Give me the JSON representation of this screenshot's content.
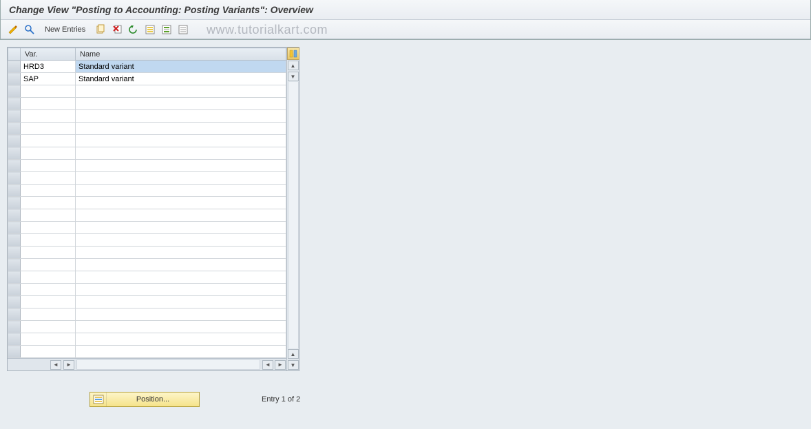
{
  "title": "Change View \"Posting to Accounting: Posting Variants\": Overview",
  "toolbar": {
    "new_entries": "New Entries"
  },
  "watermark": "www.tutorialkart.com",
  "columns": {
    "var": "Var.",
    "name": "Name"
  },
  "rows": [
    {
      "var": "HRD3",
      "name": "Standard variant",
      "selected": true
    },
    {
      "var": "SAP",
      "name": "Standard variant",
      "selected": false
    }
  ],
  "empty_row_count": 22,
  "footer": {
    "position_label": "Position...",
    "entry_text": "Entry 1 of 2"
  },
  "icons": {
    "display_change": "display-change-icon",
    "find": "find-icon",
    "copy": "copy-icon",
    "delete": "delete-icon",
    "undo": "undo-icon",
    "select_all": "select-all-icon",
    "select_block": "select-block-icon",
    "deselect_all": "deselect-all-icon",
    "config": "configuration-icon"
  }
}
